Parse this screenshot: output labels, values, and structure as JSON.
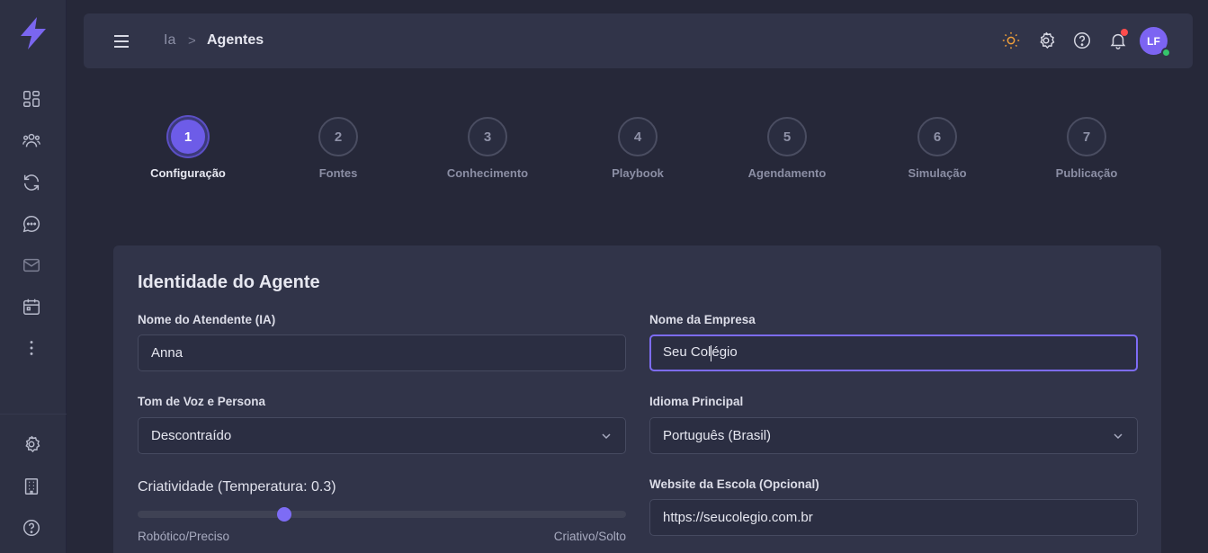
{
  "breadcrumb": {
    "parent": "Ia",
    "separator": ">",
    "current": "Agentes"
  },
  "user": {
    "initials": "LF"
  },
  "colors": {
    "accent": "#6d5ce8",
    "background": "#262839",
    "panel": "#313449",
    "online": "#35c46b",
    "notification": "#ff4d4d"
  },
  "sidebar": {
    "icons": [
      "bolt-logo-icon",
      "dashboard-icon",
      "users-icon",
      "sync-icon",
      "chat-icon",
      "mail-icon",
      "calendar-icon",
      "more-vertical-icon",
      "settings-icon",
      "building-icon",
      "help-icon"
    ]
  },
  "topbar_icons": [
    "sun-icon",
    "gear-icon",
    "help-circle-icon",
    "bell-icon"
  ],
  "steps": [
    {
      "number": "1",
      "label": "Configuração",
      "active": true
    },
    {
      "number": "2",
      "label": "Fontes",
      "active": false
    },
    {
      "number": "3",
      "label": "Conhecimento",
      "active": false
    },
    {
      "number": "4",
      "label": "Playbook",
      "active": false
    },
    {
      "number": "5",
      "label": "Agendamento",
      "active": false
    },
    {
      "number": "6",
      "label": "Simulação",
      "active": false
    },
    {
      "number": "7",
      "label": "Publicação",
      "active": false
    }
  ],
  "form": {
    "title": "Identidade do Agente",
    "attendant_name": {
      "label": "Nome do Atendente (IA)",
      "value": "Anna"
    },
    "company_name": {
      "label": "Nome da Empresa",
      "value_before_caret": "Seu Col",
      "value_after_caret": "égio"
    },
    "tone": {
      "label": "Tom de Voz e Persona",
      "value": "Descontraído"
    },
    "language": {
      "label": "Idioma Principal",
      "value": "Português (Brasil)"
    },
    "creativity": {
      "label": "Criatividade (Temperatura: 0.3)",
      "value": 0.3,
      "min_label": "Robótico/Preciso",
      "max_label": "Criativo/Solto"
    },
    "website": {
      "label": "Website da Escola (Opcional)",
      "value": "https://seucolegio.com.br"
    }
  }
}
